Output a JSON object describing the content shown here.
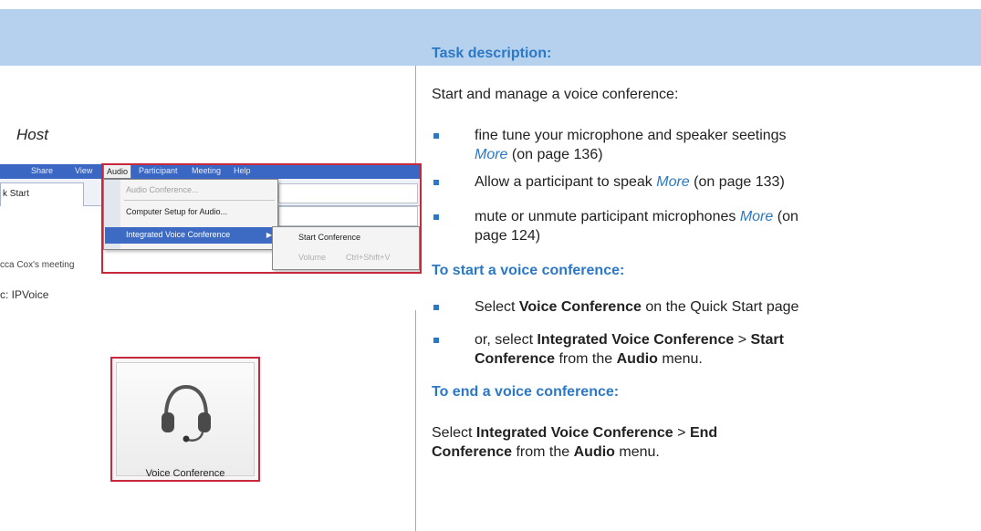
{
  "header": {
    "task_heading": "Task description:"
  },
  "left": {
    "host_label": "Host",
    "menu_screenshot": {
      "menubar": [
        "Share",
        "View",
        "Audio",
        "Participant",
        "Meeting",
        "Help"
      ],
      "start_tab": "k Start",
      "dropdown_items": [
        "Audio Conference...",
        "Computer Setup for Audio...",
        "Integrated Voice Conference"
      ],
      "submenu_items": [
        "Start Conference",
        "Volume",
        "Ctrl+Shift+V"
      ],
      "meeting_line": "cca Cox's meeting",
      "topic_line": "c:  IPVoice"
    },
    "voice_button": {
      "label": "Voice Conference",
      "icon": "headset-icon"
    }
  },
  "content": {
    "intro": "Start and manage a voice conference:",
    "bullets": [
      {
        "text": "fine tune your microphone and speaker seetings",
        "more": "More",
        "page": "(on page 136)"
      },
      {
        "text": "Allow a participant to speak",
        "more": "More",
        "page": "(on page 133)"
      },
      {
        "text": "mute or unmute participant microphones",
        "more": "More",
        "page_a": "(on",
        "page_b": "page 124)"
      }
    ],
    "start_heading": "To start a voice conference:",
    "start_steps": {
      "s1_pre": "Select",
      "s1_bold": "Voice Conference",
      "s1_post": "on the Quick Start page",
      "s2_pre": "or, select",
      "s2_b1": "Integrated Voice Conference",
      "s2_gt": ">",
      "s2_b2": "Start",
      "s2_b3": "Conference",
      "s2_mid": "from the",
      "s2_b4": "Audio",
      "s2_end": "menu."
    },
    "end_heading": "To end a voice conference:",
    "end_step": {
      "pre": "Select",
      "b1": "Integrated Voice Conference",
      "gt": ">",
      "b2": "End",
      "b3": "Conference",
      "mid": "from the",
      "b4": "Audio",
      "end": "menu."
    }
  },
  "colors": {
    "accent": "#2b78c6",
    "band": "#b5d1ee",
    "frame": "#c8283c"
  }
}
